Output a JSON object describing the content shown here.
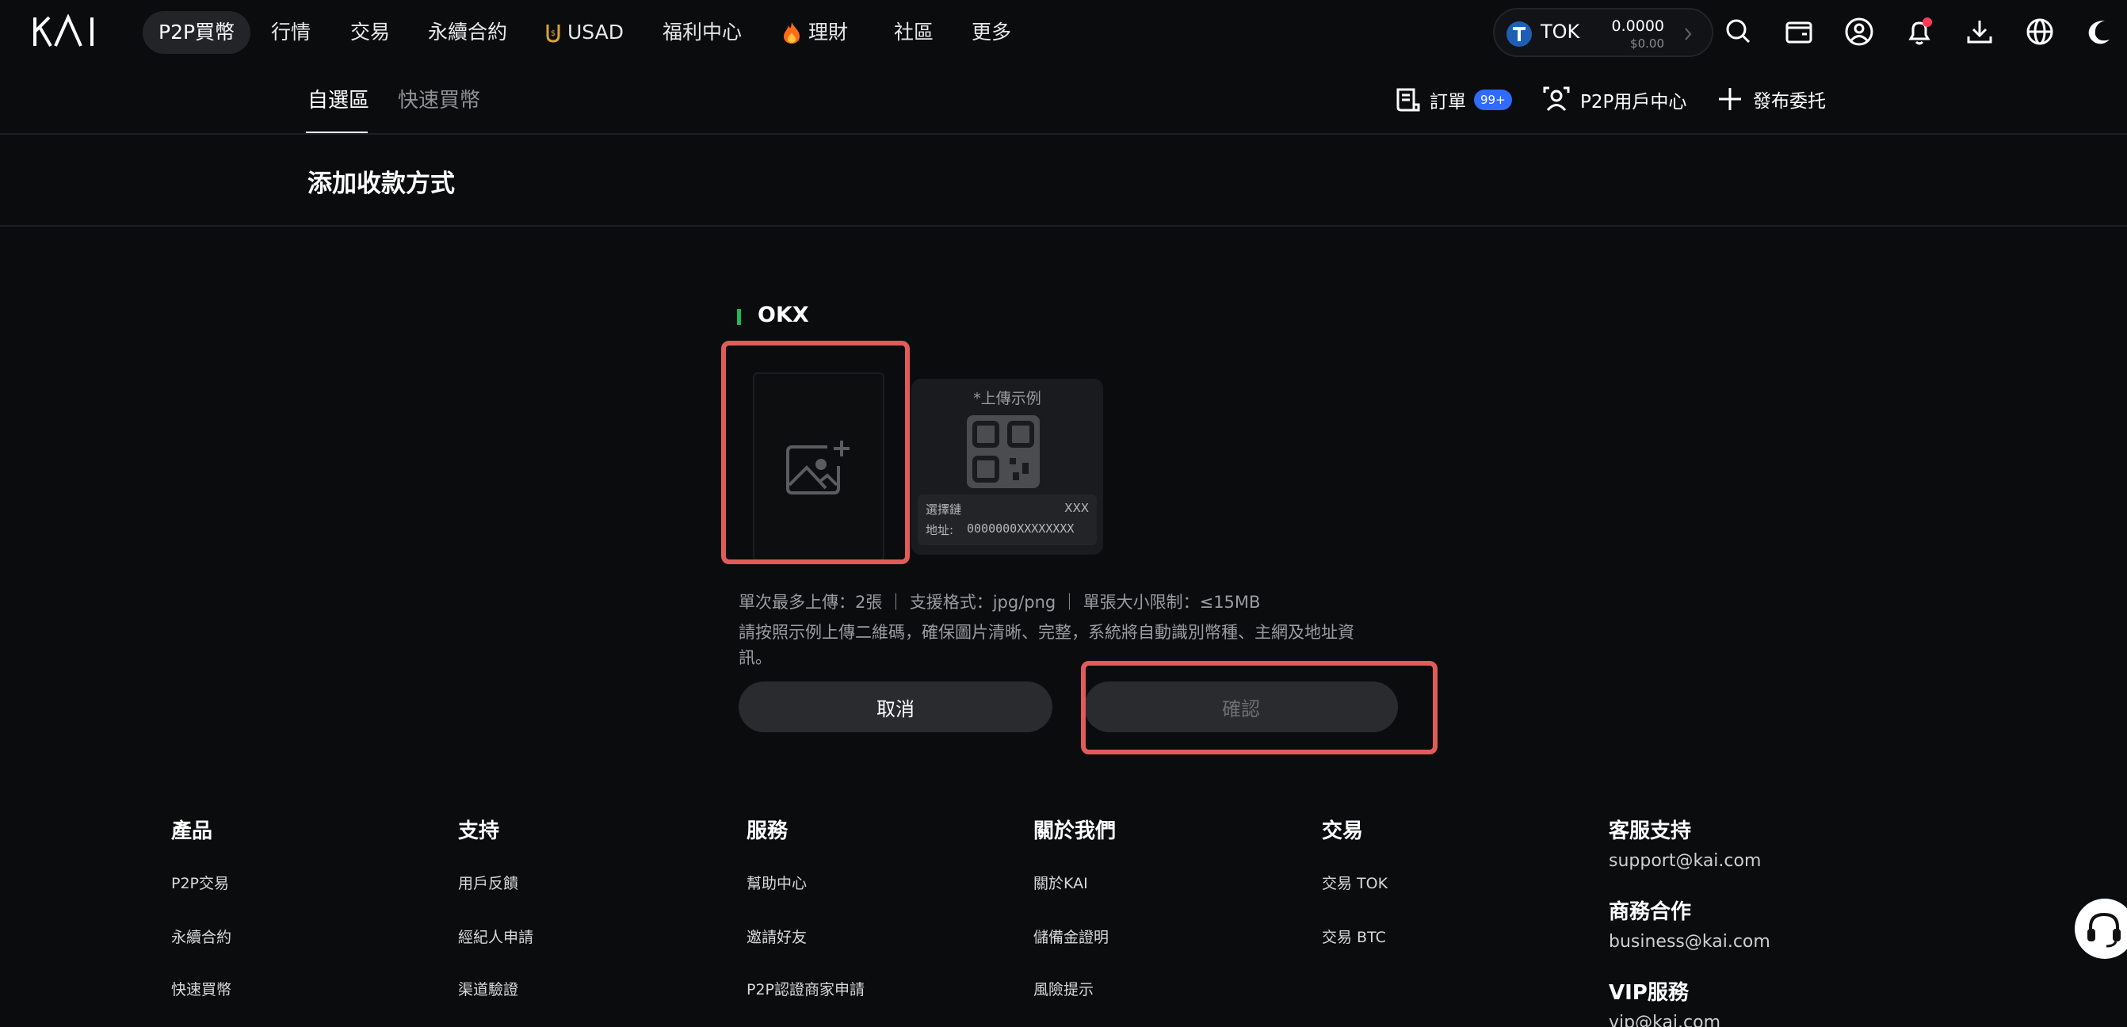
{
  "nav": {
    "logo": "KAI",
    "items": [
      {
        "label": "P2P買幣",
        "active": true
      },
      {
        "label": "行情"
      },
      {
        "label": "交易"
      },
      {
        "label": "永續合約"
      },
      {
        "label": "USAD",
        "icon": "usad-coin-icon"
      },
      {
        "label": "福利中心"
      },
      {
        "label": "理財",
        "icon": "fire-icon"
      },
      {
        "label": "社區"
      },
      {
        "label": "更多"
      }
    ],
    "balance": {
      "coin": "TOK",
      "amount": "0.0000",
      "fiat": "$0.00"
    }
  },
  "subnav": {
    "tabs": [
      {
        "label": "自選區",
        "active": true
      },
      {
        "label": "快速買幣"
      }
    ],
    "orders_label": "訂單",
    "orders_badge": "99+",
    "user_center_label": "P2P用戶中心",
    "publish_label": "發布委托"
  },
  "page": {
    "title": "添加收款方式",
    "method": "OKX",
    "sample": {
      "title": "*上傳示例",
      "chain_label": "選擇鏈",
      "chain_value": "XXX",
      "address_label": "地址:",
      "address_value": "0000000XXXXXXXX"
    },
    "hint_line1": "單次最多上傳：2張 ｜ 支援格式：jpg/png ｜ 單張大小限制：≤15MB",
    "hint_line2": "請按照示例上傳二維碼，確保圖片清晰、完整，系統將自動識別幣種、主網及地址資",
    "hint_line3": "訊。",
    "cancel_label": "取消",
    "confirm_label": "確認"
  },
  "footer": {
    "columns": [
      {
        "title": "產品",
        "links": [
          "P2P交易",
          "永續合約",
          "快速買幣"
        ]
      },
      {
        "title": "支持",
        "links": [
          "用戶反饋",
          "經紀人申請",
          "渠道驗證"
        ]
      },
      {
        "title": "服務",
        "links": [
          "幫助中心",
          "邀請好友",
          "P2P認證商家申請"
        ]
      },
      {
        "title": "關於我們",
        "links": [
          "關於KAI",
          "儲備金證明",
          "風險提示"
        ]
      },
      {
        "title": "交易",
        "links": [
          "交易 TOK",
          "交易 BTC"
        ]
      }
    ],
    "contact": [
      {
        "title": "客服支持",
        "email": "support@kai.com"
      },
      {
        "title": "商務合作",
        "email": "business@kai.com"
      },
      {
        "title": "VIP服務",
        "email": "vip@kai.com"
      }
    ]
  },
  "colors": {
    "highlight": "#e25b5b",
    "accent_green": "#1db954",
    "badge": "#2f6bff"
  }
}
